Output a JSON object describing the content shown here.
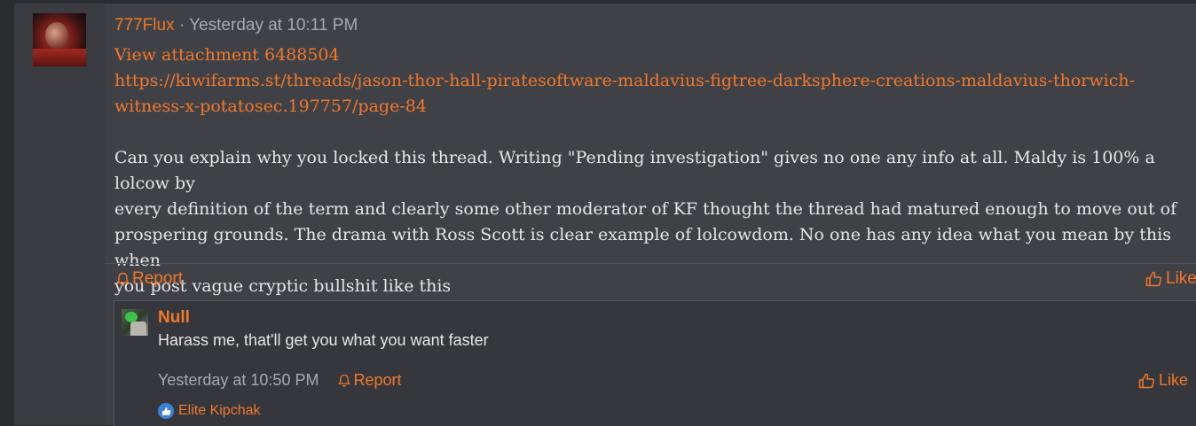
{
  "post": {
    "author": "777Flux",
    "separator": " · ",
    "timestamp": "Yesterday at 10:11 PM",
    "attachment": "View attachment 6488504",
    "url_line1": "https://kiwifarms.st/threads/jason-thor-hall-piratesoftware-maldavius-figtree-darksphere-creations-maldavius-thorwich-",
    "url_line2": "witness-x-potatosec.197757/page-84",
    "body_line1": "Can you explain why you locked this thread. Writing \"Pending investigation\" gives no one any info at all. Maldy is 100% a lolcow by",
    "body_line2": "every definition of the term and clearly some other moderator of KF thought the thread had matured enough to move out of",
    "body_line3": "prospering grounds. The drama with Ross Scott is clear example of lolcowdom. No one has any idea what you mean by this when",
    "body_line4": "you post vague cryptic bullshit like this",
    "report_label": "Report",
    "like_label": "Like"
  },
  "reply": {
    "author": "Null",
    "text": "Harass me, that'll get you what you want faster",
    "timestamp": "Yesterday at 10:50 PM",
    "report_label": "Report",
    "like_label": "Like",
    "reaction_user": "Elite Kipchak"
  },
  "icons": {
    "bell": "bell-icon",
    "thumbs_up": "thumbs-up-icon",
    "reaction": "like-reaction-icon"
  },
  "colors": {
    "accent": "#f0782b",
    "text": "#e6e6e8",
    "muted": "#a7a9ae",
    "background": "#404147",
    "reply_background": "#36373c",
    "reaction_blue": "#3b82d6"
  }
}
